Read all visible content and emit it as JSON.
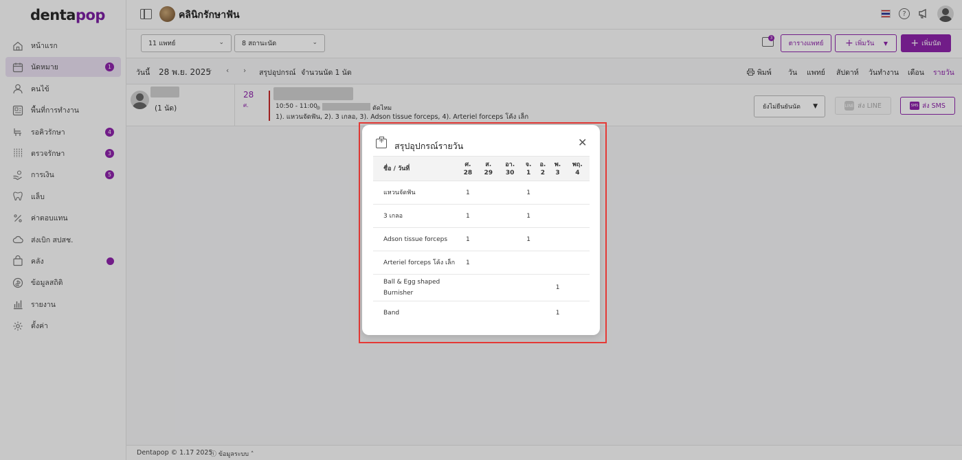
{
  "app": {
    "brand_prefix": "denta",
    "brand_suffix": "pop"
  },
  "sidebar": {
    "items": [
      {
        "label": "หน้าแรก",
        "icon": "home-icon",
        "badge": null
      },
      {
        "label": "นัดหมาย",
        "icon": "calendar-icon",
        "badge": "1",
        "active": true
      },
      {
        "label": "คนไข้",
        "icon": "user-icon",
        "badge": null
      },
      {
        "label": "พื้นที่การทำงาน",
        "icon": "workspace-icon",
        "badge": null
      },
      {
        "label": "รอคิวรักษา",
        "icon": "chair-icon",
        "badge": "4"
      },
      {
        "label": "ตรวจรักษา",
        "icon": "tools-icon",
        "badge": "3"
      },
      {
        "label": "การเงิน",
        "icon": "payment-icon",
        "badge": "5"
      },
      {
        "label": "แล็บ",
        "icon": "tooth-icon",
        "badge": null
      },
      {
        "label": "ค่าตอบแทน",
        "icon": "percent-icon",
        "badge": null
      },
      {
        "label": "ส่งเบิก สปสช.",
        "icon": "cloud-icon",
        "badge": null
      },
      {
        "label": "คลัง",
        "icon": "box-icon",
        "badge": null,
        "dot": true
      },
      {
        "label": "ข้อมูลสถิติ",
        "icon": "stats-icon",
        "badge": null
      },
      {
        "label": "รายงาน",
        "icon": "report-icon",
        "badge": null
      },
      {
        "label": "ตั้งค่า",
        "icon": "gear-icon",
        "badge": null
      }
    ]
  },
  "header": {
    "clinic_name": "คลินิกรักษาฟัน"
  },
  "filters": {
    "doctor_select": "11 แพทย์",
    "status_select": "8 สถานะนัด",
    "inbox_badge": "3",
    "schedule_button": "ตารางแพทย์",
    "add_day_button": "เพิ่มวัน",
    "add_appointment_button": "เพิ่มนัด"
  },
  "datebar": {
    "today": "วันนี้",
    "date": "28 พ.ย. 2025",
    "summary": "สรุปอุปกรณ์",
    "count": "จำนวนนัด 1 นัด",
    "print": "พิมพ์",
    "views": [
      "วัน",
      "แพทย์",
      "สัปดาห์",
      "วันทำงาน",
      "เดือน",
      "รายวัน"
    ],
    "active_view": "รายวัน"
  },
  "appointment": {
    "count": "(1 นัด)",
    "day": "28",
    "dow": "ศ.",
    "time": "10:50 - 11:00",
    "type": "ตัดไหม",
    "items": "1). แหวนจัดฟัน, 2). 3 เกลอ, 3). Adson tissue forceps, 4). Arteriel forceps โค้ง เล็ก",
    "status": "ยังไม่ยืนยันนัด",
    "line_button": "ส่ง LINE",
    "line_icon": "LINE",
    "sms_button": "ส่ง SMS",
    "sms_icon": "SMS"
  },
  "footer": {
    "copyright": "Dentapop © 1.17 2025",
    "system_info": "ข้อมูลระบบ"
  },
  "modal": {
    "title": "สรุปอุปกรณ์รายวัน",
    "name_header": "ชื่อ / วันที่",
    "days": [
      {
        "dow": "ศ.",
        "day": "28"
      },
      {
        "dow": "ส.",
        "day": "29"
      },
      {
        "dow": "อา.",
        "day": "30"
      },
      {
        "dow": "จ.",
        "day": "1"
      },
      {
        "dow": "อ.",
        "day": "2"
      },
      {
        "dow": "พ.",
        "day": "3"
      },
      {
        "dow": "พฤ.",
        "day": "4"
      }
    ],
    "rows": [
      {
        "name": "แหวนจัดฟัน",
        "values": [
          "1",
          "",
          "",
          "1",
          "",
          "",
          ""
        ]
      },
      {
        "name": "3 เกลอ",
        "values": [
          "1",
          "",
          "",
          "1",
          "",
          "",
          ""
        ]
      },
      {
        "name": "Adson tissue forceps",
        "values": [
          "1",
          "",
          "",
          "1",
          "",
          "",
          ""
        ]
      },
      {
        "name": "Arteriel forceps โค้ง เล็ก",
        "values": [
          "1",
          "",
          "",
          "",
          "",
          "",
          ""
        ]
      },
      {
        "name": "Ball & Egg shaped Burnisher",
        "values": [
          "",
          "",
          "",
          "",
          "",
          "1",
          ""
        ]
      },
      {
        "name": "Band",
        "values": [
          "",
          "",
          "",
          "",
          "",
          "1",
          ""
        ]
      }
    ]
  },
  "colors": {
    "accent": "#8e24aa",
    "highlight": "#e53935"
  }
}
